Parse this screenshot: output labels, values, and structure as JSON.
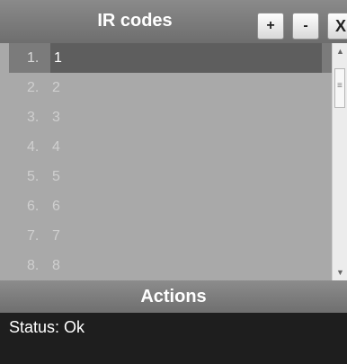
{
  "header": {
    "title": "IR codes"
  },
  "toolbar": {
    "add_label": "+",
    "remove_label": "-",
    "close_label": "X"
  },
  "list": {
    "items": [
      {
        "index": "1.",
        "value": "1",
        "selected": true
      },
      {
        "index": "2.",
        "value": "2"
      },
      {
        "index": "3.",
        "value": "3"
      },
      {
        "index": "4.",
        "value": "4"
      },
      {
        "index": "5.",
        "value": "5"
      },
      {
        "index": "6.",
        "value": "6"
      },
      {
        "index": "7.",
        "value": "7"
      },
      {
        "index": "8.",
        "value": "8"
      }
    ]
  },
  "scrollbar": {
    "up_icon": "▲",
    "down_icon": "▼",
    "grip_icon": "≡"
  },
  "actions": {
    "title": "Actions"
  },
  "status": {
    "text": "Status: Ok"
  },
  "colors": {
    "header_bg": "#7d7d7d",
    "list_bg": "#a9a9a9",
    "selected_bg": "#7b7b7b",
    "panel_bg": "#1e1e1e"
  }
}
